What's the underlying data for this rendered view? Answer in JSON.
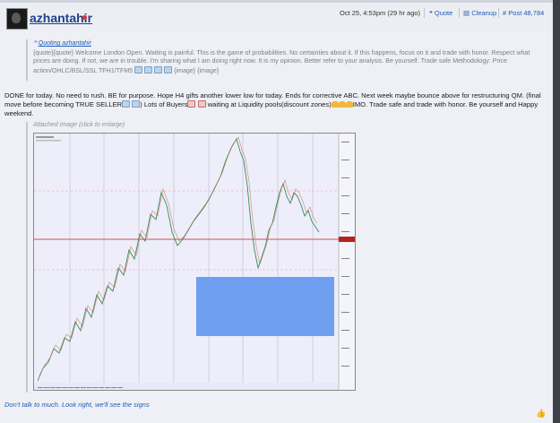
{
  "author": {
    "name": "azhantahir"
  },
  "meta": {
    "timestamp": "Oct 25, 4:53pm (29 hr ago)",
    "quote_label": "Quote",
    "cleanup_label": "Cleanup",
    "post_label": "Post 48,784"
  },
  "quote": {
    "header": "Quoting azhantahir",
    "body": "{quote}{quote} Welcome London Open. Waiting is painful. This is the game of probabilities. No certainties about it. If this happens, focus on it and trade with honor. Respect what prices are doing. If not, we are in trouble. I'm sharing what I am doing right now. It is my opinion. Better refer to your analysis. Be yourself. Trade safe Methodology: Price action/OHLC/BSL/SSL TFH1/TFM5",
    "body_tail": "{image} {image}"
  },
  "message": {
    "part1": "DONE for today. No need to rush. BE for purpose. Hope H4 gifts another lower low for today. Ends for corrective ABC. Next week maybe bounce above for restructuring QM. (final move before becoming TRUE SELLER",
    "part2": ") Lots of Buyers",
    "part3": " waiting at Liquidity pools(discount zones)",
    "part4": "IMO. Trade safe and trade with honor. Be yourself and Happy weekend."
  },
  "attachment": {
    "label": "Attached Image (click to enlarge)"
  },
  "signature": "Don't talk to much. Look right, we'll see the signs",
  "colors": {
    "link": "#1f5cb8",
    "zone": "#6f9ff0",
    "bg": "#eef0f5"
  },
  "icons": [
    "quote-icon",
    "cleanup-icon",
    "post-icon",
    "like-icon"
  ]
}
